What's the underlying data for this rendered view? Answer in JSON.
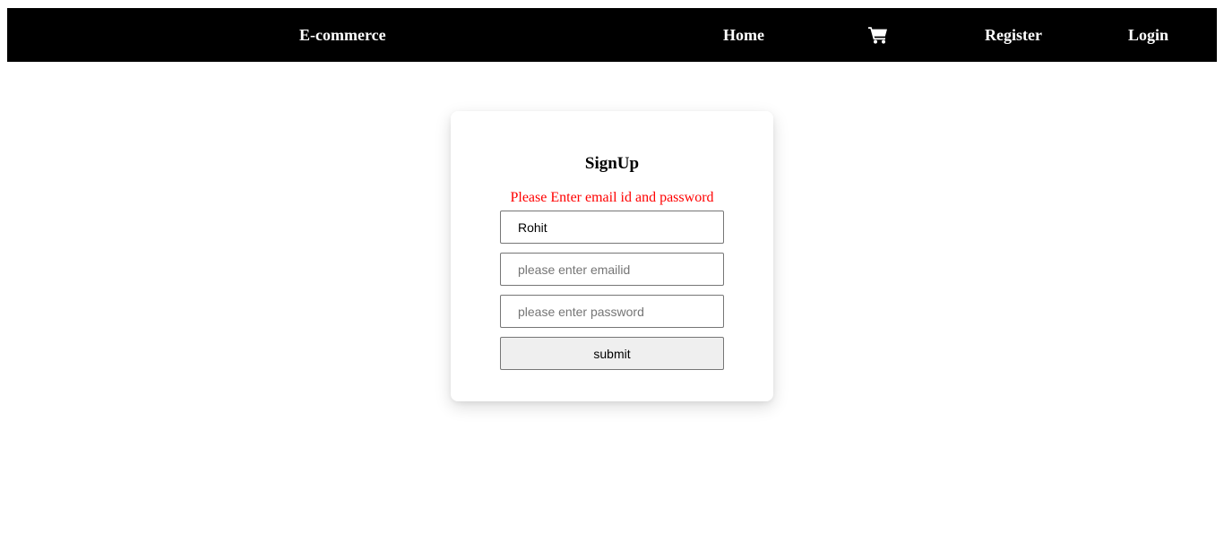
{
  "navbar": {
    "brand": "E-commerce",
    "home": "Home",
    "cart_icon": "shopping-cart-icon",
    "register": "Register",
    "login": "Login",
    "background": "#000000",
    "text_color": "#ffffff"
  },
  "form": {
    "title": "SignUp",
    "error": "Please Enter email id and password",
    "error_color": "#ff0000",
    "name_value": "Rohit",
    "email_placeholder": "please enter emailid",
    "password_placeholder": "please enter password",
    "submit_label": "submit"
  }
}
